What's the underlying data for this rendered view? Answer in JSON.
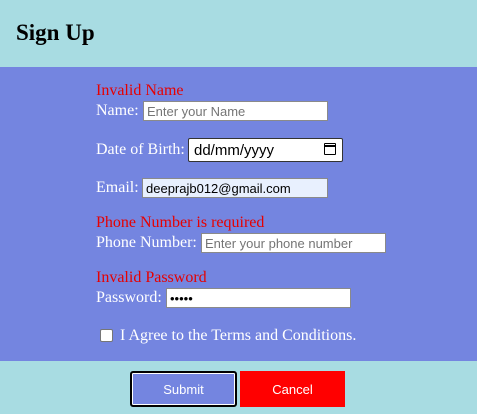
{
  "header": {
    "title": "Sign Up"
  },
  "form": {
    "name": {
      "error": "Invalid Name",
      "label": "Name:",
      "placeholder": "Enter your Name",
      "value": ""
    },
    "dob": {
      "label": "Date of Birth:",
      "value": "dd/mm/yyyy"
    },
    "email": {
      "label": "Email:",
      "value": "deeprajb012@gmail.com"
    },
    "phone": {
      "error": "Phone Number is required",
      "label": "Phone Number:",
      "placeholder": "Enter your phone number",
      "value": ""
    },
    "password": {
      "error": "Invalid Password",
      "label": "Password:",
      "value": "•••••"
    },
    "terms": {
      "label": "I Agree to the Terms and Conditions.",
      "checked": false
    }
  },
  "actions": {
    "submit_label": "Submit",
    "cancel_label": "Cancel"
  },
  "colors": {
    "page_bg": "#a8dce2",
    "form_bg": "#7485e0",
    "error": "#e60000",
    "cancel": "#ff0000"
  }
}
